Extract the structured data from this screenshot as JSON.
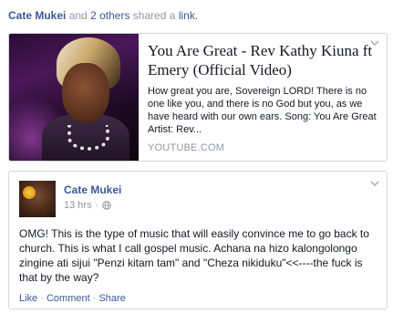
{
  "share_header": {
    "author": "Cate Mukei",
    "connector": "and",
    "others": "2 others",
    "verb": "shared a",
    "object": "link."
  },
  "link_card": {
    "title": "You Are Great - Rev Kathy Kiuna ft Emery (Official Video)",
    "description": "How great you are, Sovereign LORD! There is no one like you, and there is no God but you, as we have heard with our own ears. Song: You Are Great Artist: Rev...",
    "source": "YOUTUBE.COM"
  },
  "post": {
    "author": "Cate Mukei",
    "timestamp": "13 hrs",
    "separator": "·",
    "text": "OMG! This is the type of music that will easily convince me to go back to church. This is what I call gospel music. Achana na hizo kalongolongo zingine ati sijui \"Penzi kitam tam\" and \"Cheza nikiduku\"<<----the fuck is that by the way?",
    "actions": {
      "like": "Like",
      "comment": "Comment",
      "share": "Share",
      "separator": "·"
    }
  },
  "icons": {
    "menu": "chevron-down-icon",
    "audience": "globe-icon"
  },
  "colors": {
    "link_blue": "#3b5998",
    "meta_gray": "#9197a3",
    "border": "#d3d6db"
  }
}
